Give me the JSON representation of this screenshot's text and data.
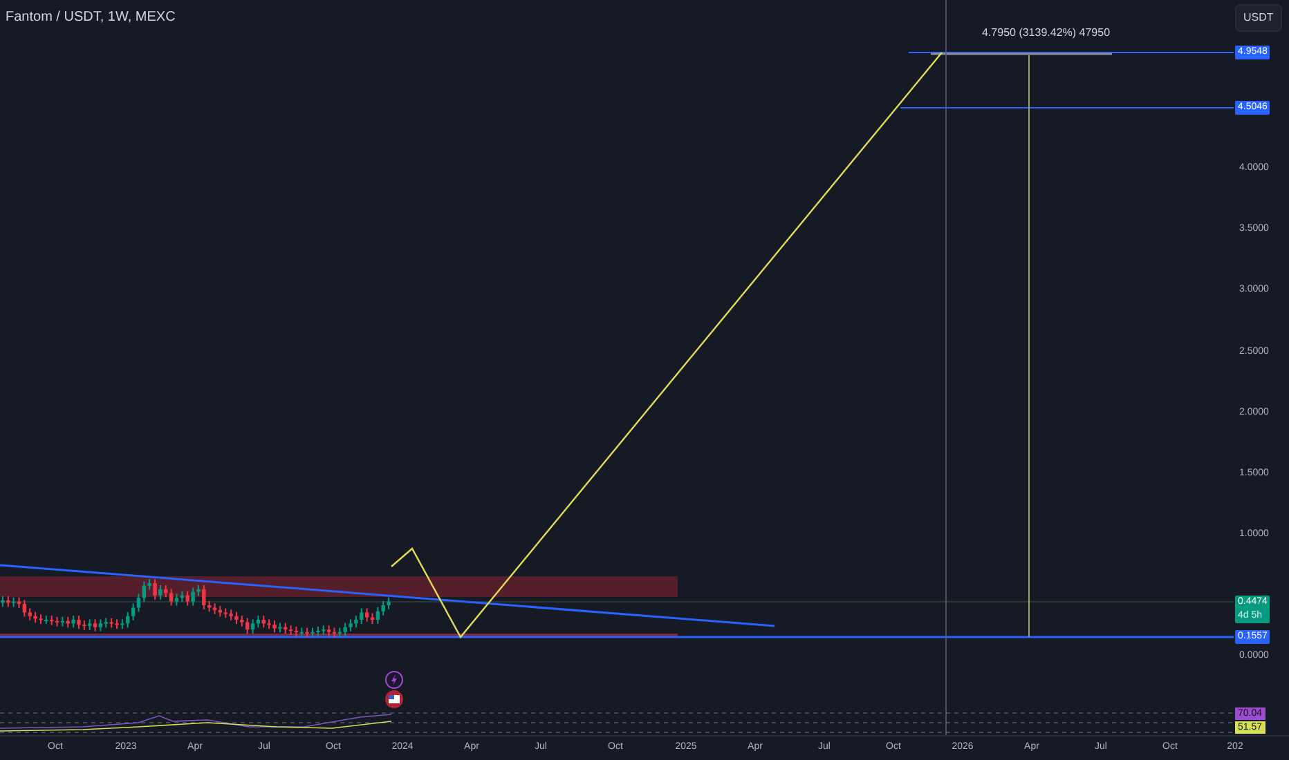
{
  "chart_title": "Fantom / USDT, 1W, MEXC",
  "currency_button": "USDT",
  "measure_label": "4.7950 (3139.42%) 47950",
  "price_ticks": [
    "4.0000",
    "3.5000",
    "3.0000",
    "2.5000",
    "2.0000",
    "1.5000",
    "1.0000",
    "0.0000"
  ],
  "price_tags": [
    {
      "kind": "line",
      "value": "4.9548",
      "color": "#2962ff"
    },
    {
      "kind": "line",
      "value": "4.5046",
      "color": "#2962ff"
    },
    {
      "kind": "last",
      "value": "0.4474",
      "countdown": "4d 5h",
      "color": "#089981"
    },
    {
      "kind": "line",
      "value": "0.1557",
      "color": "#2962ff"
    }
  ],
  "indicator_tags": [
    {
      "value": "70.04",
      "color": "#9c4ccf"
    },
    {
      "value": "51.57",
      "color": "#d4e157"
    }
  ],
  "time_ticks": [
    "Oct",
    "2023",
    "Apr",
    "Jul",
    "Oct",
    "2024",
    "Apr",
    "Jul",
    "Oct",
    "2025",
    "Apr",
    "Jul",
    "Oct",
    "2026",
    "Apr",
    "Jul",
    "Oct",
    "202"
  ]
}
